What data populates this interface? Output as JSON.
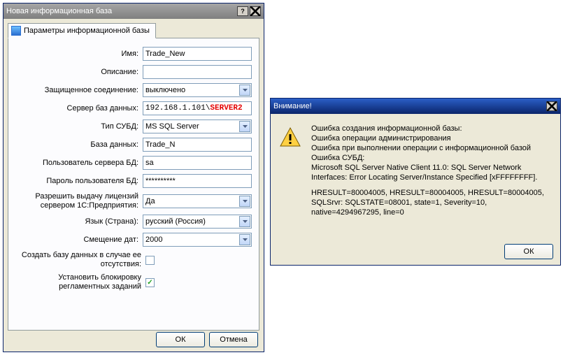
{
  "mainWindow": {
    "title": "Новая информационная база",
    "tab": "Параметры информационной базы",
    "labels": {
      "name": "Имя:",
      "desc": "Описание:",
      "secure": "Защищенное соединение:",
      "server": "Сервер баз данных:",
      "dbtype": "Тип СУБД:",
      "db": "База данных:",
      "dbuser": "Пользователь сервера БД:",
      "dbpass": "Пароль пользователя БД:",
      "lic": "Разрешить выдачу лицензий сервером 1С:Предприятия:",
      "lang": "Язык (Страна):",
      "dateoff": "Смещение дат:",
      "createdb": "Создать базу данных в случае ее отсутствия:",
      "block": "Установить блокировку регламентных заданий"
    },
    "values": {
      "name": "Trade_New",
      "desc": "",
      "secure": "выключено",
      "server_ip": "192.168.1.101\\",
      "server_name": "SERVER2",
      "dbtype": "MS SQL Server",
      "db": "Trade_N",
      "dbuser": "sa",
      "dbpass": "**********",
      "lic": "Да",
      "lang": "русский (Россия)",
      "dateoff": "2000",
      "createdb": false,
      "block": true
    },
    "buttons": {
      "ok": "ОК",
      "cancel": "Отмена"
    }
  },
  "errorDialog": {
    "title": "Внимание!",
    "lines": [
      "Ошибка создания информационной базы:",
      "Ошибка операции администрирования",
      "Ошибка при выполнении операции с информационной базой",
      "Ошибка СУБД:",
      "Microsoft SQL Server Native Client 11.0: SQL Server Network Interfaces: Error Locating Server/Instance Specified [xFFFFFFFF]."
    ],
    "lines2": [
      "HRESULT=80004005, HRESULT=80004005, HRESULT=80004005,",
      "SQLSrvr: SQLSTATE=08001, state=1, Severity=10,",
      "native=4294967295, line=0"
    ],
    "ok": "ОК"
  }
}
